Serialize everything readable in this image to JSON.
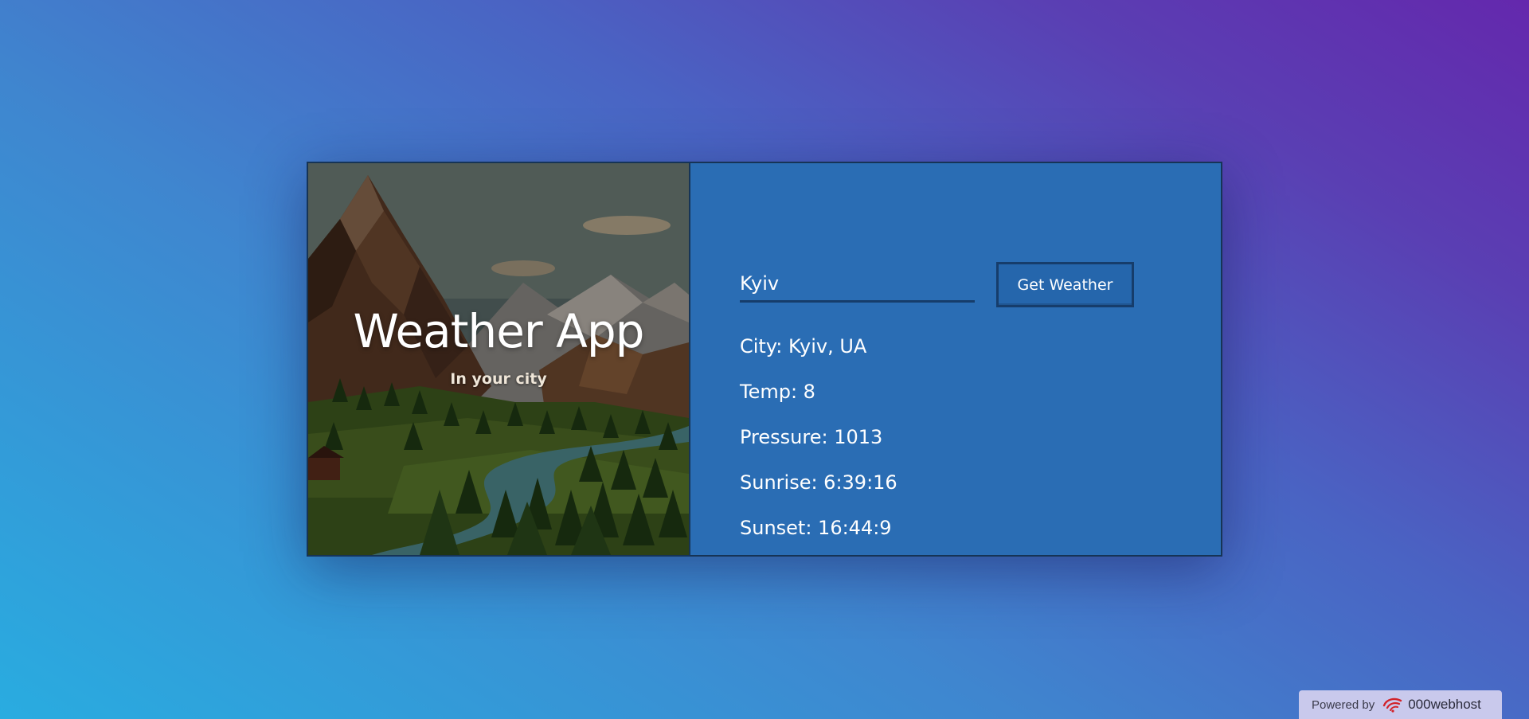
{
  "hero": {
    "title": "Weather App",
    "subtitle": "In your city"
  },
  "search": {
    "value": "Kyiv",
    "button_label": "Get Weather"
  },
  "results": [
    "City: Kyiv, UA",
    "Temp: 8",
    "Pressure: 1013",
    "Sunrise: 6:39:16",
    "Sunset: 16:44:9"
  ],
  "badge": {
    "powered_label": "Powered by",
    "brand": "000webhost",
    "logo_icon": "000webhost-logo-icon"
  },
  "colors": {
    "panel_blue": "#2a6db4",
    "border_navy": "#163456",
    "badge_bg": "#c9c9ec"
  }
}
